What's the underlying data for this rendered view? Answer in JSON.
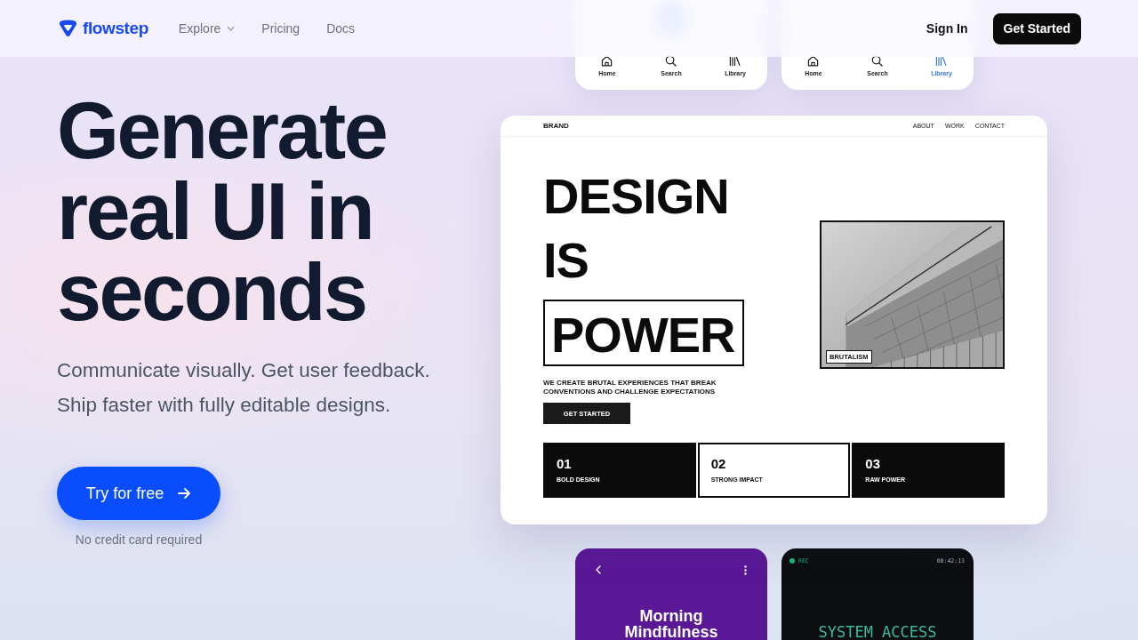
{
  "header": {
    "logo": "flowstep",
    "nav": [
      {
        "label": "Explore",
        "dropdown": true
      },
      {
        "label": "Pricing",
        "dropdown": false
      },
      {
        "label": "Docs",
        "dropdown": false
      }
    ],
    "sign_in": "Sign In",
    "cta": "Get Started"
  },
  "hero": {
    "title": "Generate real UI in seconds",
    "subtitle": "Communicate visually. Get user feedback. Ship faster with fully editable designs.",
    "button": "Try for free",
    "note": "No credit card required"
  },
  "showcase": {
    "tab_cards": [
      {
        "tabs": [
          {
            "label": "Home",
            "kind": "home",
            "selected": false
          },
          {
            "label": "Search",
            "kind": "search",
            "selected": false
          },
          {
            "label": "Library",
            "kind": "library",
            "selected": false
          }
        ]
      },
      {
        "tabs": [
          {
            "label": "Home",
            "kind": "home",
            "selected": false
          },
          {
            "label": "Search",
            "kind": "search",
            "selected": false
          },
          {
            "label": "Library",
            "kind": "library",
            "selected": true
          }
        ]
      }
    ],
    "brand_site": {
      "brand": "BRAND",
      "nav": [
        "ABOUT",
        "WORK",
        "CONTACT"
      ],
      "headline": [
        {
          "text": "DESIGN",
          "boxed": false
        },
        {
          "text": "IS",
          "boxed": false
        },
        {
          "text": "POWER",
          "boxed": true
        }
      ],
      "tagline": "WE CREATE BRUTAL EXPERIENCES THAT BREAK CONVENTIONS AND CHALLENGE EXPECTATIONS",
      "button": "GET STARTED",
      "photo_label": "BRUTALISM",
      "features": [
        {
          "number": "01",
          "label": "BOLD DESIGN",
          "kind": "filled"
        },
        {
          "number": "02",
          "label": "STRONG IMPACT",
          "kind": "outline"
        },
        {
          "number": "03",
          "label": "RAW POWER",
          "kind": "filled"
        }
      ]
    },
    "app_cards": [
      {
        "kind": "player",
        "title": "Morning Mindfulness"
      },
      {
        "kind": "recorder",
        "status": "REC",
        "time": "00:42:13",
        "title": "SYSTEM ACCESS"
      }
    ]
  }
}
